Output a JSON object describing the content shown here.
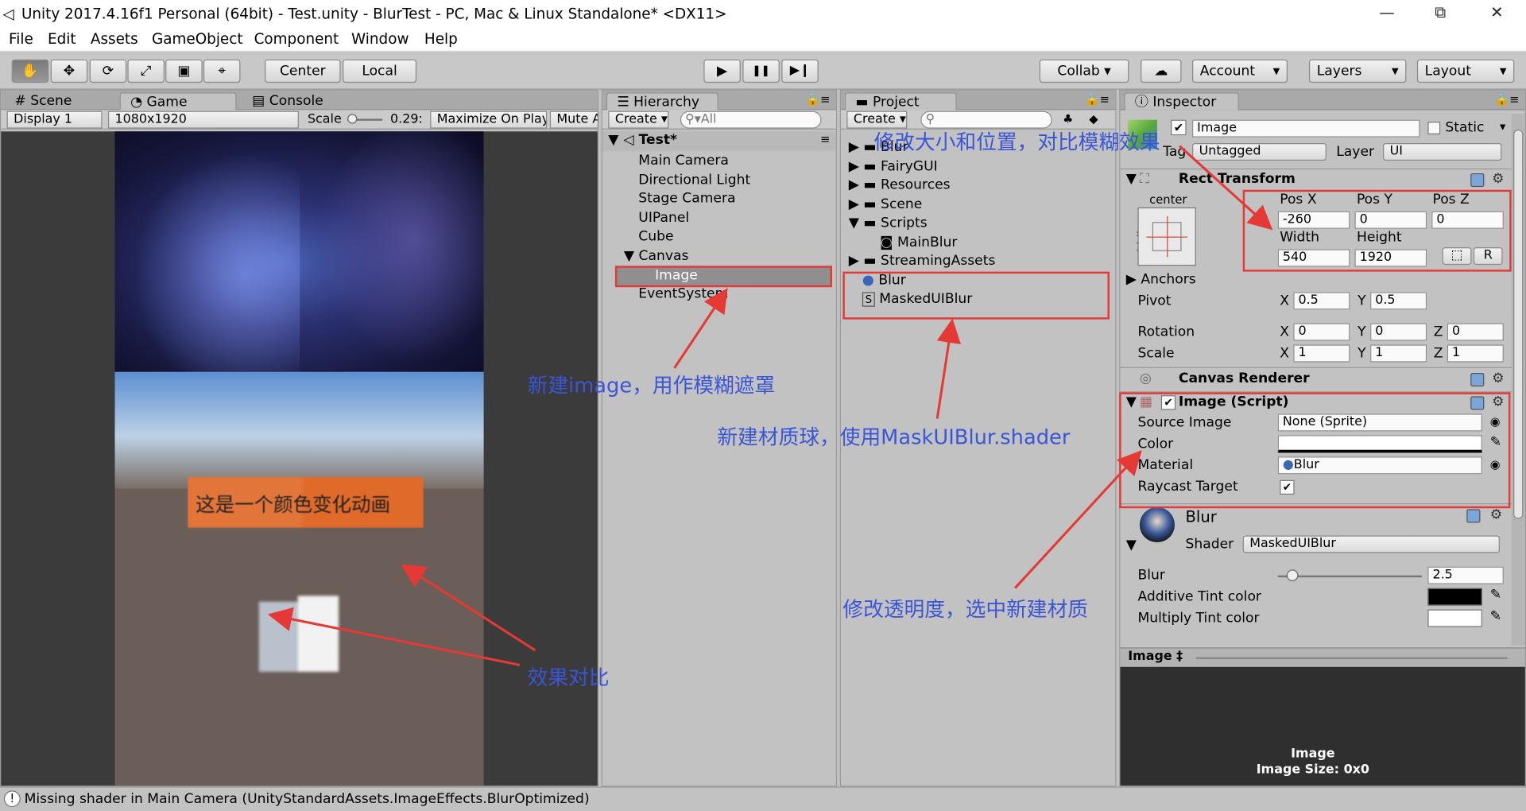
{
  "window": {
    "title": "Unity 2017.4.16f1 Personal (64bit) - Test.unity - BlurTest - PC, Mac & Linux Standalone* <DX11>",
    "minimize": "—",
    "maximize": "⧉",
    "close": "✕"
  },
  "menu": [
    "File",
    "Edit",
    "Assets",
    "GameObject",
    "Component",
    "Window",
    "Help"
  ],
  "toolbar": {
    "tools": [
      "✋",
      "✥",
      "⟳",
      "⤢",
      "▣",
      "⌖"
    ],
    "pivot": "Center",
    "space": "Local",
    "play": "▶",
    "pause": "❚❚",
    "step": "▶❙",
    "collab": "Collab ▾",
    "cloud": "☁",
    "account": "Account",
    "layers": "Layers",
    "layout": "Layout",
    "dropdown_arrow": "▾"
  },
  "game_panel": {
    "tabs": [
      "Scene",
      "Game",
      "Console"
    ],
    "display": "Display 1",
    "resolution": "1080x1920",
    "scale_label": "Scale",
    "scale_value": "0.29:",
    "maximize_on_play": "Maximize On Play",
    "mute": "Mute A",
    "banner_text": "这是一个颜色变化动画"
  },
  "hierarchy": {
    "title": "Hierarchy",
    "create": "Create",
    "search_placeholder": "All",
    "scene": "Test*",
    "items": [
      "Main Camera",
      "Directional Light",
      "Stage Camera",
      "UIPanel",
      "Cube",
      "Canvas",
      "Image",
      "EventSystem"
    ]
  },
  "project": {
    "title": "Project",
    "create": "Create",
    "folders": [
      "Blur",
      "FairyGUI",
      "Resources",
      "Scene",
      "Scripts"
    ],
    "scripts_child": "MainBlur",
    "streaming": "StreamingAssets",
    "assets": [
      "Blur",
      "MaskedUIBlur"
    ]
  },
  "inspector": {
    "title": "Inspector",
    "object_name": "Image",
    "static": "Static",
    "tag_label": "Tag",
    "tag": "Untagged",
    "layer_label": "Layer",
    "layer": "UI",
    "rect": {
      "title": "Rect Transform",
      "anchor_h": "center",
      "anchor_v": "middle",
      "headers": [
        "Pos X",
        "Pos Y",
        "Pos Z"
      ],
      "pos": [
        "-260",
        "0",
        "0"
      ],
      "size_headers": [
        "Width",
        "Height"
      ],
      "size": [
        "540",
        "1920"
      ],
      "r": "R",
      "blueprint": "⬚",
      "anchors": "Anchors",
      "pivot": "Pivot",
      "pivot_vals": [
        "0.5",
        "0.5"
      ],
      "rotation": "Rotation",
      "rotation_vals": [
        "0",
        "0",
        "0"
      ],
      "scale": "Scale",
      "scale_vals": [
        "1",
        "1",
        "1"
      ],
      "axes": [
        "X",
        "Y",
        "Z"
      ]
    },
    "canvas_renderer": "Canvas Renderer",
    "image_script": {
      "title": "Image (Script)",
      "source_label": "Source Image",
      "source": "None (Sprite)",
      "color_label": "Color",
      "material_label": "Material",
      "material": "Blur",
      "raycast_label": "Raycast Target",
      "check": "✔",
      "circle": "◉"
    },
    "material": {
      "name": "Blur",
      "shader_label": "Shader",
      "shader": "MaskedUIBlur",
      "blur_label": "Blur",
      "blur_value": "2.5",
      "blur_level": 0.1,
      "additive_label": "Additive Tint color",
      "multiply_label": "Multiply Tint color"
    },
    "preview": {
      "header": "Image ‡",
      "name": "Image",
      "size": "Image Size: 0x0"
    }
  },
  "status": "Missing shader in Main Camera (UnityStandardAssets.ImageEffects.BlurOptimized)",
  "annotations": {
    "resize": "修改大小和位置，对比模糊效果",
    "new_image": "新建image，用作模糊遮罩",
    "new_material": "新建材质球，使用MaskUIBlur.shader",
    "alpha": "修改透明度，选中新建材质",
    "compare": "效果对比"
  },
  "colors": {
    "annotation": "#3a55d6",
    "highlight": "#e53935",
    "banner": "#e06a2a",
    "game_bg": "#3b3b3b"
  }
}
